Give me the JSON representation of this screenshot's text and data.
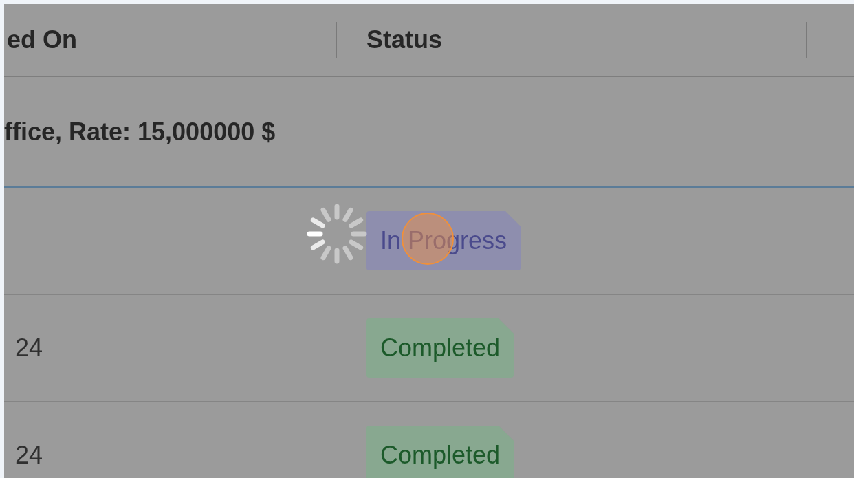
{
  "table": {
    "columns": [
      {
        "label": "ed On"
      },
      {
        "label": "Status"
      }
    ],
    "group": {
      "label": "ffice, Rate: 15,000000 $"
    },
    "rows": [
      {
        "status": {
          "label": "In Progress",
          "kind": "in-progress"
        },
        "loading": true,
        "clicked": true
      },
      {
        "date": "24",
        "status": {
          "label": "Completed",
          "kind": "completed"
        },
        "loading": false,
        "clicked": false
      },
      {
        "date": "24",
        "status": {
          "label": "Completed",
          "kind": "completed"
        },
        "loading": false,
        "clicked": false
      }
    ]
  }
}
